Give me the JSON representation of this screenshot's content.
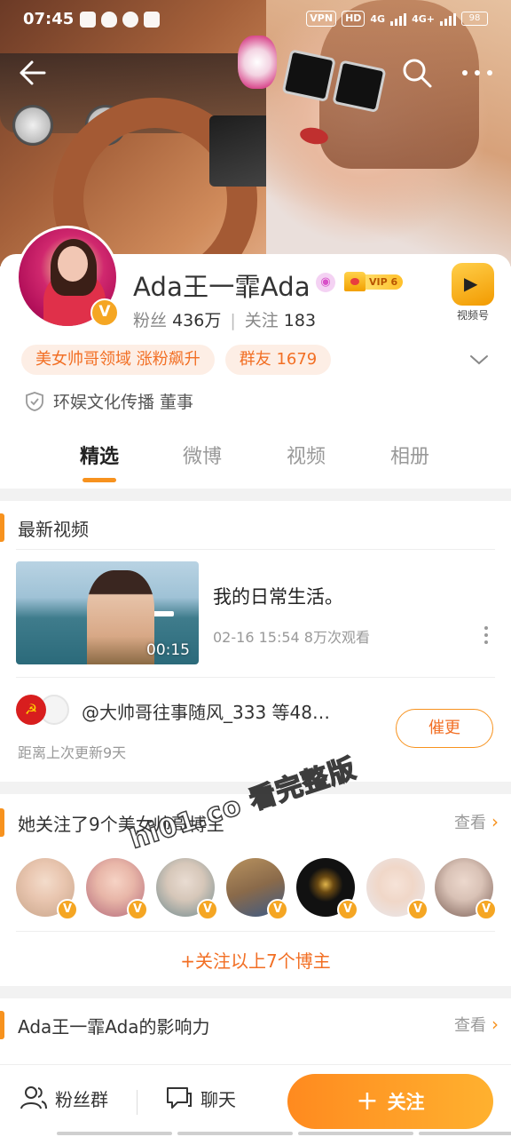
{
  "status_bar": {
    "time": "07:45",
    "vpn": "VPN",
    "hd": "HD",
    "network_1": "4G",
    "network_2": "4G+",
    "battery": "98"
  },
  "profile": {
    "name": "Ada王一霏Ada",
    "vip_level": "VIP 6",
    "verified_mark": "V",
    "fans_label": "粉丝",
    "fans_count": "436万",
    "following_label": "关注",
    "following_count": "183",
    "video_channel_label": "视频号",
    "tags": [
      "美女帅哥领域 涨粉飙升",
      "群友 1679"
    ],
    "company": "环娱文化传播 董事"
  },
  "tabs": [
    {
      "label": "精选",
      "active": true
    },
    {
      "label": "微博",
      "active": false
    },
    {
      "label": "视频",
      "active": false
    },
    {
      "label": "相册",
      "active": false
    }
  ],
  "latest_video": {
    "section_title": "最新视频",
    "title": "我的日常生活。",
    "meta": "02-16 15:54 8万次观看",
    "duration": "00:15"
  },
  "updater": {
    "flag_glyph": "☭",
    "users": "@大帅哥往事随风_333 等48…",
    "since": "距离上次更新9天",
    "urge_button": "催更"
  },
  "following": {
    "section_title": "她关注了9个美女帅哥博主",
    "more_label": "查看",
    "follow_all": "+关注以上7个博主",
    "avatars": [
      {
        "name": "blogger-1",
        "color": "#e9c6b0"
      },
      {
        "name": "blogger-2",
        "color": "#e8b6a8"
      },
      {
        "name": "blogger-3",
        "color": "#d6c7b9"
      },
      {
        "name": "blogger-4",
        "color": "#8a6a4a"
      },
      {
        "name": "blogger-5",
        "color": "#111111"
      },
      {
        "name": "blogger-6",
        "color": "#f0d7c8"
      },
      {
        "name": "blogger-7",
        "color": "#d9c2b6"
      }
    ]
  },
  "influence": {
    "section_title": "Ada王一霏Ada的影响力",
    "more_label": "查看"
  },
  "bottom_bar": {
    "fans_group": "粉丝群",
    "chat": "聊天",
    "follow": "关注"
  },
  "watermark": "hi01.co 看完整版",
  "colors": {
    "accent": "#f7921e",
    "accent_text": "#f26f24",
    "pill_bg": "#fdeee5",
    "badge": "#f5a623"
  }
}
